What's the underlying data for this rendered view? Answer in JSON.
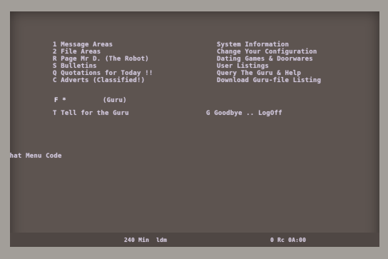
{
  "menu": {
    "left_items": [
      "1 Message Areas",
      "2 File Areas",
      "R Page Mr D. (The Robot)",
      "S Bulletins",
      "Q Quotations for Today !!",
      "C Adverts (Classified!)"
    ],
    "right_items": [
      "System Information",
      "Change Your Configuration",
      "Dating Games & Doorwares",
      "User Listings",
      "Query The Guru & Help",
      "Download Guru-file Listing"
    ],
    "hotkey_row": {
      "key": "F *",
      "label": "(Guru)"
    },
    "talk_item": "T Tell for the Guru",
    "goodbye_item": "G Goodbye .. LogOff"
  },
  "prompt": {
    "text": "What Menu Code"
  },
  "status_bar": {
    "left": "240 Min  ldm",
    "right": "0 Rc 0A:00"
  }
}
